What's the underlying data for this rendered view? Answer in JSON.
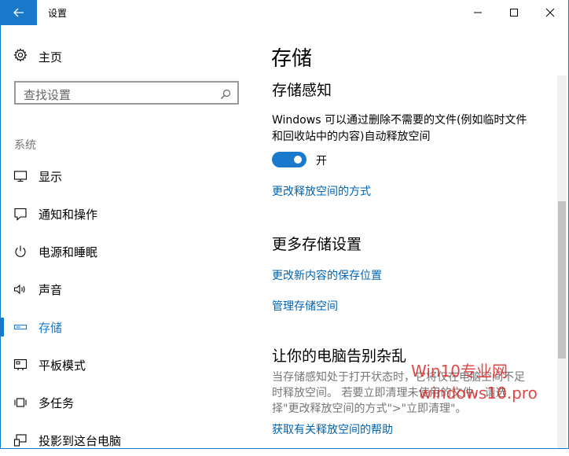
{
  "window": {
    "title": "设置",
    "accent_color": "#1979ca",
    "controls": {
      "minimize_icon": "minimize-icon",
      "maximize_icon": "maximize-icon",
      "close_icon": "close-icon"
    }
  },
  "sidebar": {
    "home_label": "主页",
    "search_placeholder": "查找设置",
    "section_label": "系统",
    "items": [
      {
        "label": "显示",
        "icon": "display-icon",
        "active": false
      },
      {
        "label": "通知和操作",
        "icon": "notification-icon",
        "active": false
      },
      {
        "label": "电源和睡眠",
        "icon": "power-icon",
        "active": false
      },
      {
        "label": "声音",
        "icon": "speaker-icon",
        "active": false
      },
      {
        "label": "存储",
        "icon": "storage-icon",
        "active": true
      },
      {
        "label": "平板模式",
        "icon": "tablet-icon",
        "active": false
      },
      {
        "label": "多任务",
        "icon": "multitask-icon",
        "active": false
      },
      {
        "label": "投影到这台电脑",
        "icon": "project-icon",
        "active": false
      }
    ]
  },
  "main": {
    "page_title": "存储",
    "storage_sense": {
      "heading": "存储感知",
      "description_line1": "Windows 可以通过删除不需要的文件(例如临时文件",
      "description_line2": "和回收站中的内容)自动释放空间",
      "toggle_state": "on",
      "toggle_label": "开",
      "change_link": "更改释放空间的方式"
    },
    "more_settings": {
      "heading": "更多存储设置",
      "link_save_location": "更改新内容的保存位置",
      "link_manage_spaces": "管理存储空间"
    },
    "declutter": {
      "heading": "让你的电脑告别杂乱",
      "text_line1": "当存储感知处于打开状态时，它将仅在电脑空间不足",
      "text_line2": "时释放空间。 若要立即清理未使用的文件，请选",
      "text_line3": "择\"更改释放空间的方式\">\"立即清理\"。",
      "help_link": "获取有关释放空间的帮助"
    }
  },
  "watermark": {
    "line1": "Win10专业网",
    "line2": "windows10.pro"
  }
}
